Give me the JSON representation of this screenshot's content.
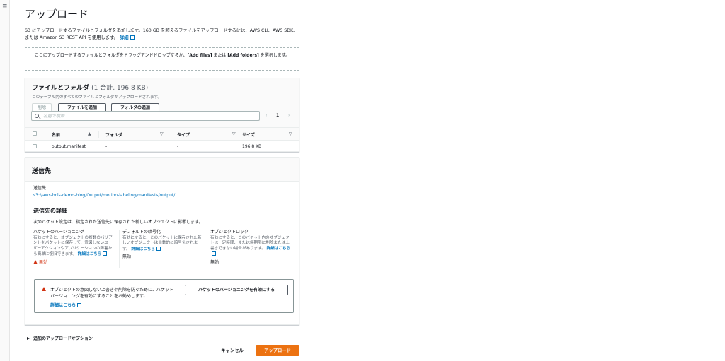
{
  "nav": {
    "menu_icon": "≡"
  },
  "page": {
    "title": "アップロード"
  },
  "intro": {
    "text": "S3 にアップロードするファイルとフォルダを追加します。160 GB を超えるファイルをアップロードするには、AWS CLI、AWS SDK、または Amazon S3 REST API を使用します。",
    "link": "詳細"
  },
  "dropzone": {
    "pre": "ここにアップロードするファイルとフォルダをドラッグアンドドロップするか、",
    "add_files": "[Add files]",
    "mid": " または ",
    "add_folders": "[Add folders]",
    "post": " を選択します。"
  },
  "files": {
    "title": "ファイルとフォルダ",
    "count": "(1 合計, 196.8 KB)",
    "description": "このテーブル内のすべてのファイルとフォルダがアップロードされます。",
    "remove_label": "削除",
    "add_files_label": "ファイルを追加",
    "add_folder_label": "フォルダの追加",
    "search_placeholder": "名前で検索",
    "page_number": "1",
    "prev": "‹",
    "next": "›",
    "columns": {
      "name": "名前",
      "folder": "フォルダ",
      "type": "タイプ",
      "size": "サイズ"
    },
    "sort_asc": "▲",
    "sort_desc": "▽",
    "rows": [
      {
        "name": "output.manifest",
        "folder": "-",
        "type": "-",
        "size": "196.8 KB"
      }
    ]
  },
  "destination": {
    "title": "送信先",
    "label": "送信先",
    "path": "s3://aws-hcls-demo-blog/Output/motion-labeling/manifests/output/",
    "details_title": "送信先の詳細",
    "details_desc": "次のバケット設定は、指定された送信先に保存された新しいオブジェクトに影響します。",
    "versioning": {
      "title": "バケットのバージョニング",
      "desc": "有効にすると、オブジェクトの複数のバリアントをバケットに保存して、意図しないユーザーアクションやアプリケーションの障害から簡単に復旧できます。",
      "link": "詳細はこちら",
      "value": "無効"
    },
    "encryption": {
      "title": "デフォルトの暗号化",
      "desc": "有効にすると、このバケットに保存された新しいオブジェクトは自動的に暗号化されます。",
      "link": "詳細はこちら",
      "value": "無効"
    },
    "lock": {
      "title": "オブジェクトロック",
      "desc": "有効にすると、このバケット内のオブジェクトは一定時間、または無期限に削除または上書きできない場合があります。",
      "link": "詳細はこちら",
      "value": "無効"
    },
    "alert": {
      "text": "オブジェクトの意図しない上書きや削除を防ぐために、バケットバージョニングを有効にすることをお勧めします。",
      "link": "詳細はこちら",
      "button": "バケットのバージョニングを有効にする"
    }
  },
  "footer": {
    "more_options": "追加のアップロードオプション",
    "cancel": "キャンセル",
    "upload": "アップロード"
  },
  "colors": {
    "accent": "#ec7211",
    "link": "#0073bb",
    "error": "#d13212"
  }
}
